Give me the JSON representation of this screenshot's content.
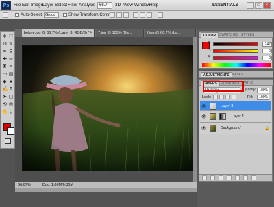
{
  "menubar": {
    "logo": "Ps",
    "items": [
      "File",
      "Edit",
      "Image",
      "Layer",
      "Select",
      "Filter",
      "Analysis",
      "3D",
      "View",
      "Window",
      "Help"
    ],
    "zoom": "66.7",
    "workspace": "ESSENTIALS",
    "window_controls": [
      "–",
      "□",
      "×"
    ]
  },
  "options": {
    "auto_select_label": "Auto-Select:",
    "auto_select_value": "Group",
    "transform_label": "Show Transform Controls"
  },
  "tabs": [
    {
      "label": "before.jpg @ 66.7% (Layer 3, RGB/8) *",
      "active": true
    },
    {
      "label": "7.jpg @ 100% (Ba...",
      "active": false
    },
    {
      "label": "f.jpg @ 66.7% (La...",
      "active": false
    }
  ],
  "statusbar": {
    "zoom": "66.67%",
    "doc_size": "Doc: 1.06M/6.30M"
  },
  "color_panel": {
    "tabs": [
      "COLOR",
      "SWATCHES",
      "STYLES"
    ],
    "channels": [
      {
        "letter": "R",
        "value": "247"
      },
      {
        "letter": "G",
        "value": "0"
      },
      {
        "letter": "B",
        "value": "0"
      }
    ],
    "foreground_color": "#f70000"
  },
  "adjust_panel": {
    "tabs": [
      "ADJUSTMENTS",
      "MASKS"
    ]
  },
  "layers_panel": {
    "tabs": [
      "LAYERS",
      "CHANNELS",
      "PATHS"
    ],
    "blend_mode": "Multiply",
    "opacity_label": "Opacity:",
    "opacity_value": "100%",
    "lock_label": "Lock:",
    "fill_label": "Fill:",
    "fill_value": "100%",
    "layers": [
      {
        "name": "Layer 3",
        "selected": true
      },
      {
        "name": "Layer 1",
        "selected": false
      },
      {
        "name": "Background",
        "selected": false
      }
    ]
  },
  "colors": {
    "accent": "#3d8ce8",
    "highlight": "#e00000"
  }
}
